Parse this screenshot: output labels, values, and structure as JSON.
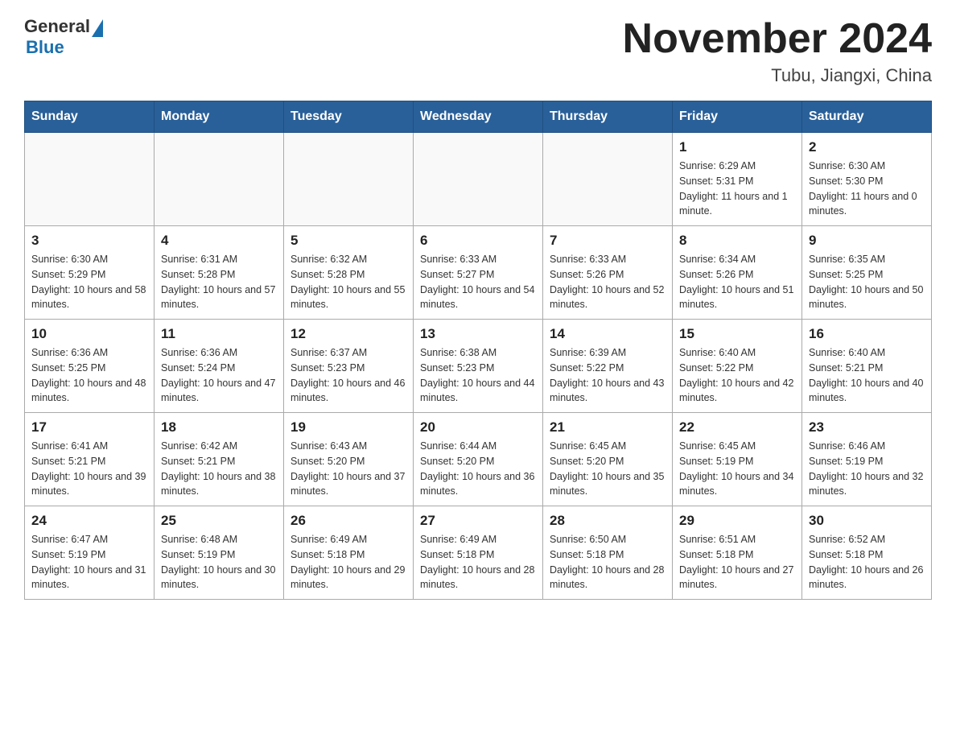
{
  "header": {
    "logo_general": "General",
    "logo_blue": "Blue",
    "title": "November 2024",
    "subtitle": "Tubu, Jiangxi, China"
  },
  "weekdays": [
    "Sunday",
    "Monday",
    "Tuesday",
    "Wednesday",
    "Thursday",
    "Friday",
    "Saturday"
  ],
  "weeks": [
    [
      {
        "day": "",
        "info": ""
      },
      {
        "day": "",
        "info": ""
      },
      {
        "day": "",
        "info": ""
      },
      {
        "day": "",
        "info": ""
      },
      {
        "day": "",
        "info": ""
      },
      {
        "day": "1",
        "info": "Sunrise: 6:29 AM\nSunset: 5:31 PM\nDaylight: 11 hours and 1 minute."
      },
      {
        "day": "2",
        "info": "Sunrise: 6:30 AM\nSunset: 5:30 PM\nDaylight: 11 hours and 0 minutes."
      }
    ],
    [
      {
        "day": "3",
        "info": "Sunrise: 6:30 AM\nSunset: 5:29 PM\nDaylight: 10 hours and 58 minutes."
      },
      {
        "day": "4",
        "info": "Sunrise: 6:31 AM\nSunset: 5:28 PM\nDaylight: 10 hours and 57 minutes."
      },
      {
        "day": "5",
        "info": "Sunrise: 6:32 AM\nSunset: 5:28 PM\nDaylight: 10 hours and 55 minutes."
      },
      {
        "day": "6",
        "info": "Sunrise: 6:33 AM\nSunset: 5:27 PM\nDaylight: 10 hours and 54 minutes."
      },
      {
        "day": "7",
        "info": "Sunrise: 6:33 AM\nSunset: 5:26 PM\nDaylight: 10 hours and 52 minutes."
      },
      {
        "day": "8",
        "info": "Sunrise: 6:34 AM\nSunset: 5:26 PM\nDaylight: 10 hours and 51 minutes."
      },
      {
        "day": "9",
        "info": "Sunrise: 6:35 AM\nSunset: 5:25 PM\nDaylight: 10 hours and 50 minutes."
      }
    ],
    [
      {
        "day": "10",
        "info": "Sunrise: 6:36 AM\nSunset: 5:25 PM\nDaylight: 10 hours and 48 minutes."
      },
      {
        "day": "11",
        "info": "Sunrise: 6:36 AM\nSunset: 5:24 PM\nDaylight: 10 hours and 47 minutes."
      },
      {
        "day": "12",
        "info": "Sunrise: 6:37 AM\nSunset: 5:23 PM\nDaylight: 10 hours and 46 minutes."
      },
      {
        "day": "13",
        "info": "Sunrise: 6:38 AM\nSunset: 5:23 PM\nDaylight: 10 hours and 44 minutes."
      },
      {
        "day": "14",
        "info": "Sunrise: 6:39 AM\nSunset: 5:22 PM\nDaylight: 10 hours and 43 minutes."
      },
      {
        "day": "15",
        "info": "Sunrise: 6:40 AM\nSunset: 5:22 PM\nDaylight: 10 hours and 42 minutes."
      },
      {
        "day": "16",
        "info": "Sunrise: 6:40 AM\nSunset: 5:21 PM\nDaylight: 10 hours and 40 minutes."
      }
    ],
    [
      {
        "day": "17",
        "info": "Sunrise: 6:41 AM\nSunset: 5:21 PM\nDaylight: 10 hours and 39 minutes."
      },
      {
        "day": "18",
        "info": "Sunrise: 6:42 AM\nSunset: 5:21 PM\nDaylight: 10 hours and 38 minutes."
      },
      {
        "day": "19",
        "info": "Sunrise: 6:43 AM\nSunset: 5:20 PM\nDaylight: 10 hours and 37 minutes."
      },
      {
        "day": "20",
        "info": "Sunrise: 6:44 AM\nSunset: 5:20 PM\nDaylight: 10 hours and 36 minutes."
      },
      {
        "day": "21",
        "info": "Sunrise: 6:45 AM\nSunset: 5:20 PM\nDaylight: 10 hours and 35 minutes."
      },
      {
        "day": "22",
        "info": "Sunrise: 6:45 AM\nSunset: 5:19 PM\nDaylight: 10 hours and 34 minutes."
      },
      {
        "day": "23",
        "info": "Sunrise: 6:46 AM\nSunset: 5:19 PM\nDaylight: 10 hours and 32 minutes."
      }
    ],
    [
      {
        "day": "24",
        "info": "Sunrise: 6:47 AM\nSunset: 5:19 PM\nDaylight: 10 hours and 31 minutes."
      },
      {
        "day": "25",
        "info": "Sunrise: 6:48 AM\nSunset: 5:19 PM\nDaylight: 10 hours and 30 minutes."
      },
      {
        "day": "26",
        "info": "Sunrise: 6:49 AM\nSunset: 5:18 PM\nDaylight: 10 hours and 29 minutes."
      },
      {
        "day": "27",
        "info": "Sunrise: 6:49 AM\nSunset: 5:18 PM\nDaylight: 10 hours and 28 minutes."
      },
      {
        "day": "28",
        "info": "Sunrise: 6:50 AM\nSunset: 5:18 PM\nDaylight: 10 hours and 28 minutes."
      },
      {
        "day": "29",
        "info": "Sunrise: 6:51 AM\nSunset: 5:18 PM\nDaylight: 10 hours and 27 minutes."
      },
      {
        "day": "30",
        "info": "Sunrise: 6:52 AM\nSunset: 5:18 PM\nDaylight: 10 hours and 26 minutes."
      }
    ]
  ]
}
